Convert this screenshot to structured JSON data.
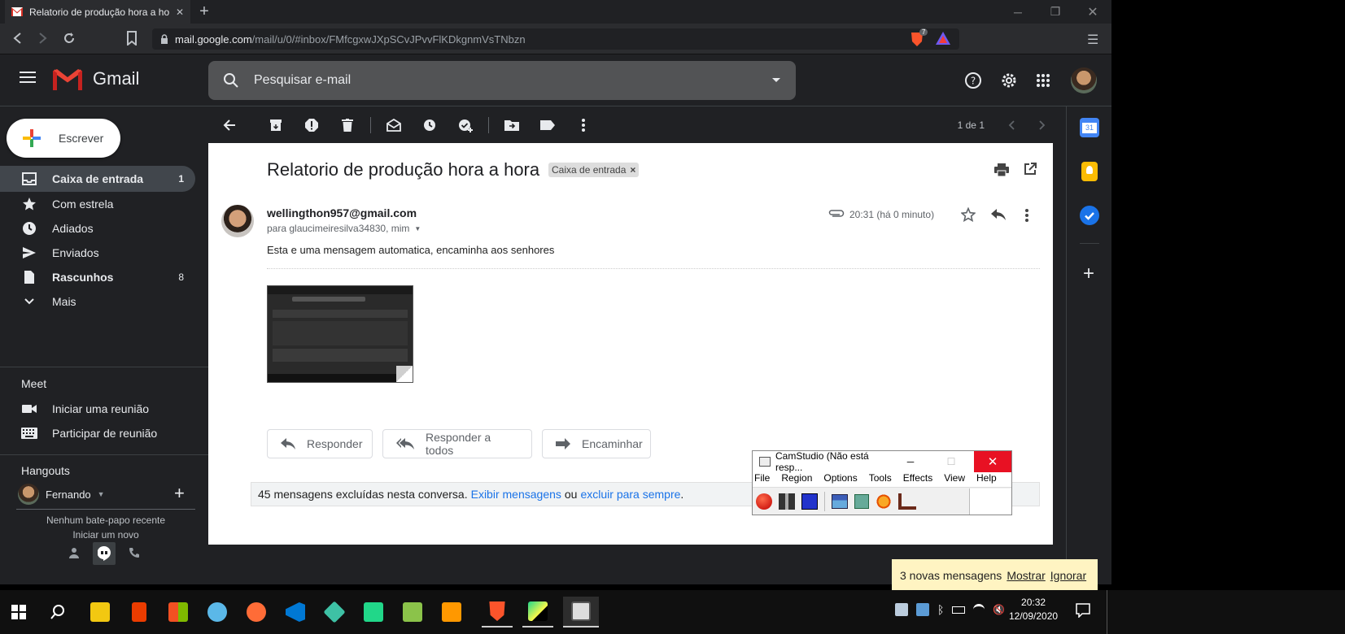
{
  "browser": {
    "tab_title": "Relatorio de produção hora a hora",
    "url_host": "mail.google.com",
    "url_path": "/mail/u/0/#inbox/FMfcgxwJXpSCvJPvvFlKDkgnmVsTNbzn",
    "brave_badge": "7"
  },
  "gmail": {
    "logo_text": "Gmail",
    "search_placeholder": "Pesquisar e-mail",
    "compose_label": "Escrever",
    "nav": [
      {
        "label": "Caixa de entrada",
        "count": "1",
        "icon": "inbox-icon"
      },
      {
        "label": "Com estrela",
        "count": "",
        "icon": "star-icon"
      },
      {
        "label": "Adiados",
        "count": "",
        "icon": "clock-icon"
      },
      {
        "label": "Enviados",
        "count": "",
        "icon": "send-icon"
      },
      {
        "label": "Rascunhos",
        "count": "8",
        "icon": "draft-icon"
      },
      {
        "label": "Mais",
        "count": "",
        "icon": "chevron-down-icon"
      }
    ],
    "meet": {
      "title": "Meet",
      "items": [
        {
          "label": "Iniciar uma reunião",
          "icon": "video-icon"
        },
        {
          "label": "Participar de reunião",
          "icon": "keyboard-icon"
        }
      ]
    },
    "hangouts": {
      "title": "Hangouts",
      "user": "Fernando",
      "empty_text": "Nenhum bate-papo recente",
      "start_new": "Iniciar um novo"
    },
    "pagination": "1 de 1",
    "message": {
      "subject": "Relatorio de produção hora a hora",
      "label_chip": "Caixa de entrada",
      "sender": "wellingthon957@gmail.com",
      "recipients": "para glaucimeiresilva34830, mim",
      "time": "20:31 (há 0 minuto)",
      "body": "Esta e uma mensagem automatica, encaminha aos senhores",
      "reply": "Responder",
      "reply_all": "Responder a todos",
      "forward": "Encaminhar",
      "deleted_notice": "45 mensagens excluídas nesta conversa.",
      "show_link": "Exibir mensagens",
      "or_text": "ou",
      "delete_link": "excluir para sempre",
      "period": "."
    }
  },
  "camstudio": {
    "title": "CamStudio (Não está resp...",
    "menu": [
      "File",
      "Region",
      "Options",
      "Tools",
      "Effects",
      "View",
      "Help"
    ]
  },
  "notification": {
    "text": "3 novas mensagens",
    "show": "Mostrar",
    "ignore": "Ignorar"
  },
  "taskbar": {
    "time": "20:32",
    "date": "12/09/2020"
  },
  "colors": {
    "gmail_bg": "#202124",
    "selected_nav": "#41464c",
    "link": "#1a73e8",
    "close_red": "#e81123"
  }
}
